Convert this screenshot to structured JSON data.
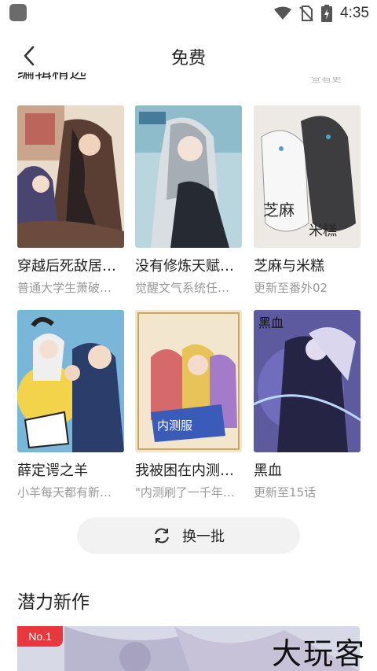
{
  "status_bar": {
    "time": "4:35"
  },
  "header": {
    "title": "免费"
  },
  "prev_section": {
    "title": "编辑精选",
    "more": "查看更多"
  },
  "comics": [
    {
      "title": "穿越后死敌居…",
      "subtitle": "普通大学生萧破…"
    },
    {
      "title": "没有修炼天赋…",
      "subtitle": "觉醒文气系统任…"
    },
    {
      "title": "芝麻与米糕",
      "subtitle": "更新至番外02"
    },
    {
      "title": "薛定谔之羊",
      "subtitle": "小羊每天都有新…"
    },
    {
      "title": "我被困在内测…",
      "subtitle": "\"内测刷了一千年…"
    },
    {
      "title": "黑血",
      "subtitle": "更新至15话"
    }
  ],
  "refresh": {
    "label": "换一批"
  },
  "new_section": {
    "title": "潜力新作",
    "badge": "No.1"
  },
  "watermark": "大玩客",
  "icons": [
    "app-icon",
    "wifi-icon",
    "no-sim-icon",
    "battery-icon",
    "back-icon",
    "refresh-icon"
  ],
  "colors": {
    "badge": "#e8383d",
    "refresh_bg": "#f2f2f2",
    "subtitle": "#999999"
  }
}
